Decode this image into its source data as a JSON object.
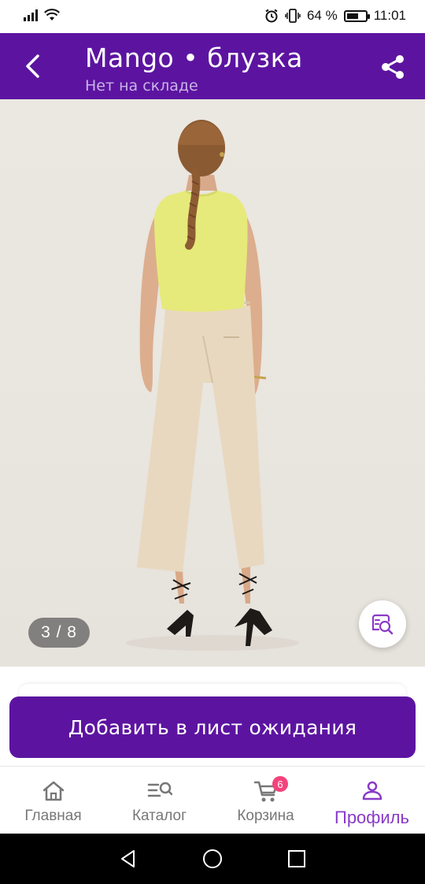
{
  "status_bar": {
    "battery_percent": "64 %",
    "battery_level": 0.64,
    "time": "11:01"
  },
  "header": {
    "title": "Mango  •  блузка",
    "subtitle": "Нет на складе",
    "background": "#5c14a0"
  },
  "gallery": {
    "counter": "3 / 8"
  },
  "actions": {
    "waitlist_label": "Добавить в лист ожидания"
  },
  "bottom_nav": {
    "items": [
      {
        "label": "Главная",
        "icon": "home-icon"
      },
      {
        "label": "Каталог",
        "icon": "catalog-search-icon"
      },
      {
        "label": "Корзина",
        "icon": "cart-icon",
        "badge": "6"
      },
      {
        "label": "Профиль",
        "icon": "profile-icon",
        "active": true
      }
    ]
  },
  "colors": {
    "brand": "#5c14a0",
    "active_tab": "#8a3ac7",
    "badge": "#f5437c"
  }
}
